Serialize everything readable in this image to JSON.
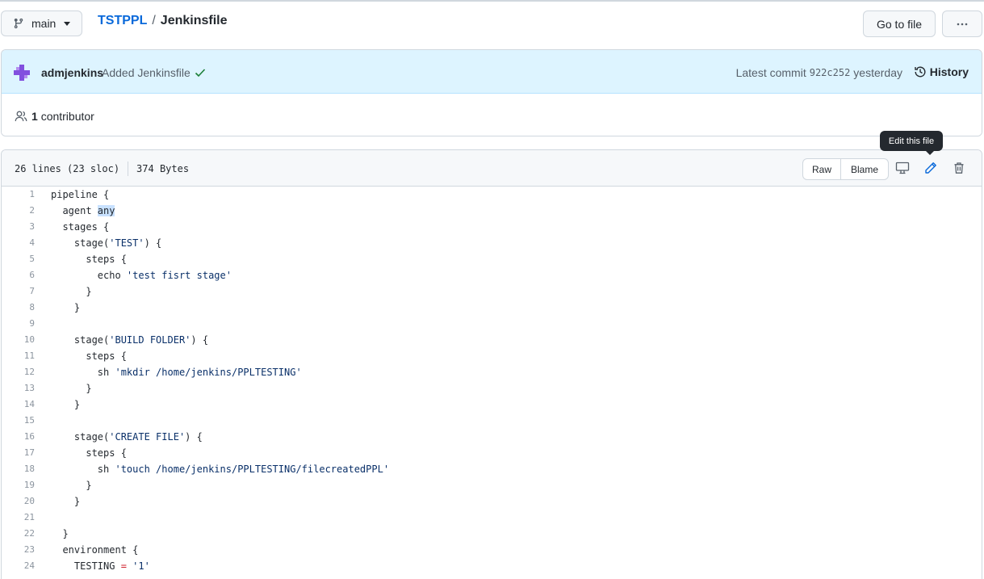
{
  "branch": {
    "name": "main"
  },
  "breadcrumb": {
    "repo": "TSTPPL",
    "separator": "/",
    "file": "Jenkinsfile"
  },
  "toolbar": {
    "goto_file": "Go to file",
    "more": "···"
  },
  "commit": {
    "author": "admjenkins",
    "message": "Added Jenkinsfile",
    "latest_prefix": "Latest commit",
    "sha": "922c252",
    "time": "yesterday",
    "history_label": "History"
  },
  "contributors": {
    "count": "1",
    "label": "contributor"
  },
  "file_header": {
    "lines": "26 lines (23 sloc)",
    "size": "374 Bytes",
    "raw_label": "Raw",
    "blame_label": "Blame",
    "tooltip": "Edit this file"
  },
  "code_lines": [
    {
      "n": "1",
      "text": "pipeline {"
    },
    {
      "n": "2",
      "text": "  agent any"
    },
    {
      "n": "3",
      "text": "  stages {"
    },
    {
      "n": "4",
      "text": "    stage('TEST') {"
    },
    {
      "n": "5",
      "text": "      steps {"
    },
    {
      "n": "6",
      "text": "        echo 'test fisrt stage'"
    },
    {
      "n": "7",
      "text": "      }"
    },
    {
      "n": "8",
      "text": "    }"
    },
    {
      "n": "9",
      "text": ""
    },
    {
      "n": "10",
      "text": "    stage('BUILD FOLDER') {"
    },
    {
      "n": "11",
      "text": "      steps {"
    },
    {
      "n": "12",
      "text": "        sh 'mkdir /home/jenkins/PPLTESTING'"
    },
    {
      "n": "13",
      "text": "      }"
    },
    {
      "n": "14",
      "text": "    }"
    },
    {
      "n": "15",
      "text": ""
    },
    {
      "n": "16",
      "text": "    stage('CREATE FILE') {"
    },
    {
      "n": "17",
      "text": "      steps {"
    },
    {
      "n": "18",
      "text": "        sh 'touch /home/jenkins/PPLTESTING/filecreatedPPL'"
    },
    {
      "n": "19",
      "text": "      }"
    },
    {
      "n": "20",
      "text": "    }"
    },
    {
      "n": "21",
      "text": ""
    },
    {
      "n": "22",
      "text": "  }"
    },
    {
      "n": "23",
      "text": "  environment {"
    },
    {
      "n": "24",
      "text": "    TESTING = '1'"
    }
  ],
  "colors": {
    "link": "#0969da",
    "commit_bg": "#ddf4ff",
    "check": "#1a7f37",
    "avatar": "#8250df"
  },
  "icons": [
    "git-branch-icon",
    "kebab-horizontal-icon",
    "avatar-icon",
    "check-icon",
    "history-icon",
    "people-icon",
    "desktop-icon",
    "pencil-icon",
    "trash-icon"
  ]
}
